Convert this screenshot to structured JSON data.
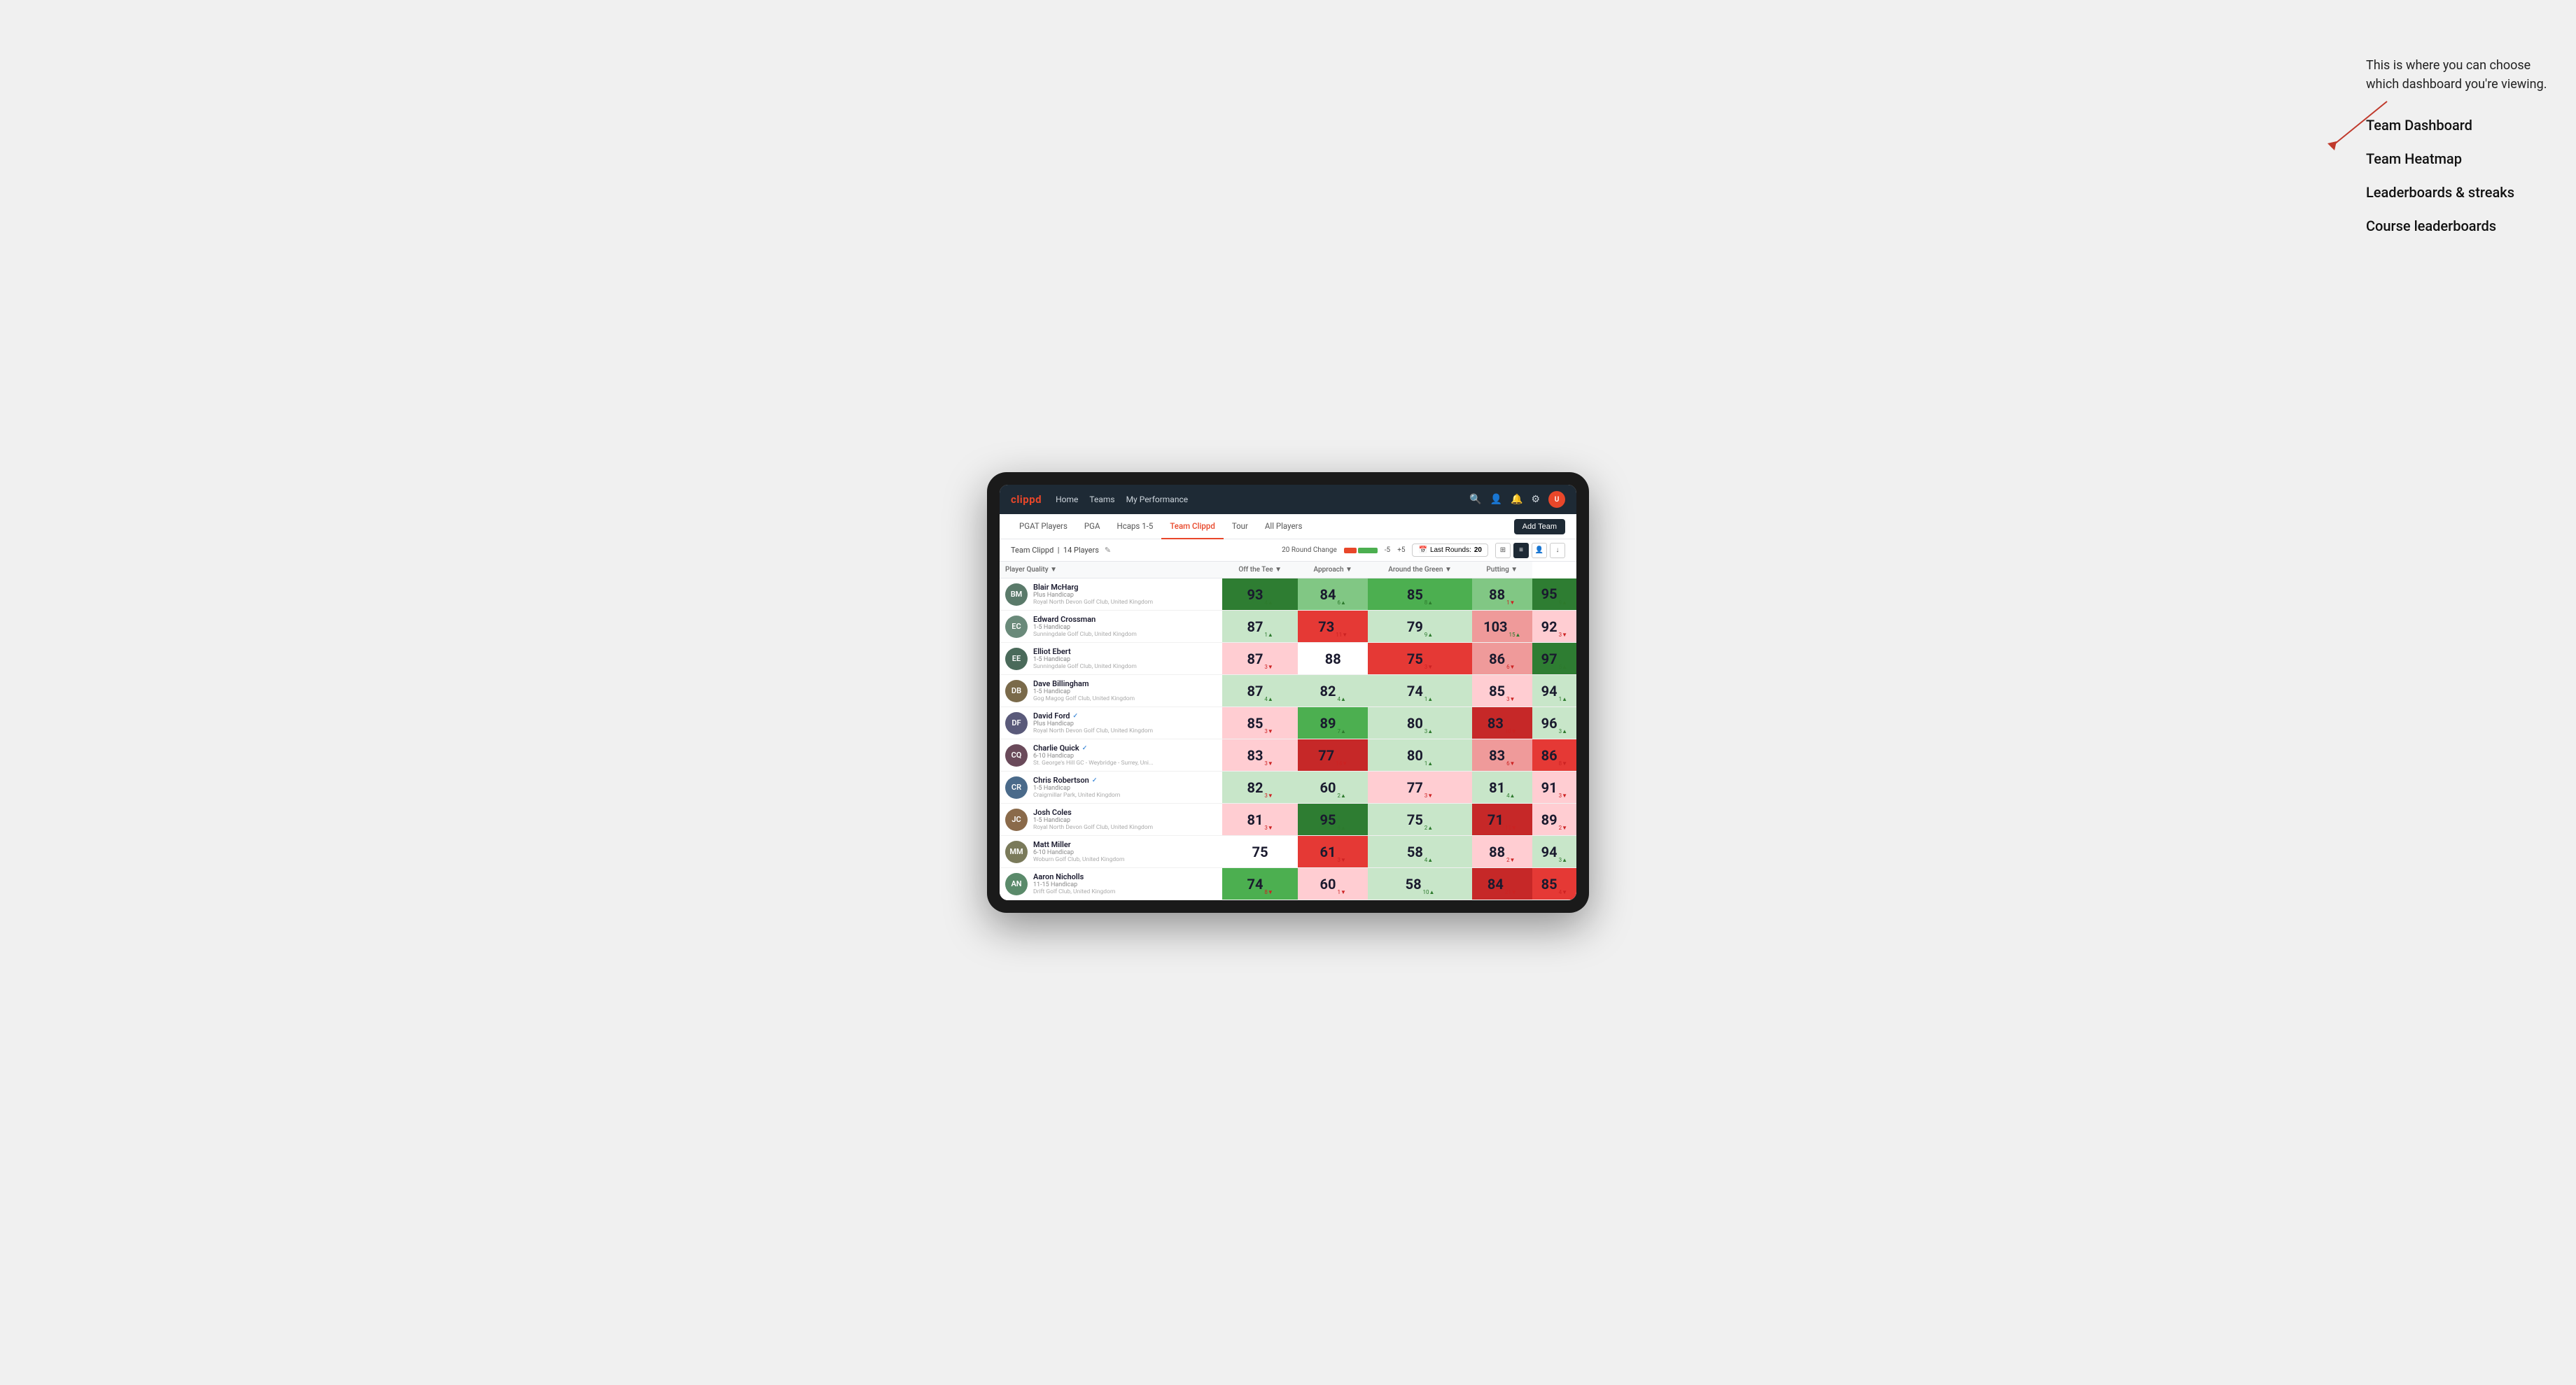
{
  "annotation": {
    "intro": "This is where you can choose which dashboard you're viewing.",
    "items": [
      "Team Dashboard",
      "Team Heatmap",
      "Leaderboards & streaks",
      "Course leaderboards"
    ]
  },
  "navbar": {
    "brand": "clippd",
    "links": [
      "Home",
      "Teams",
      "My Performance"
    ],
    "add_team_label": "Add Team"
  },
  "sub_nav": {
    "tabs": [
      "PGAT Players",
      "PGA",
      "Hcaps 1-5",
      "Team Clippd",
      "Tour",
      "All Players"
    ],
    "active_tab": "Team Clippd"
  },
  "team_header": {
    "team_name": "Team Clippd",
    "player_count": "14 Players",
    "round_change_label": "20 Round Change",
    "neg_label": "-5",
    "pos_label": "+5",
    "last_rounds_label": "Last Rounds:",
    "last_rounds_value": "20"
  },
  "table": {
    "columns": {
      "player": "Player Quality",
      "off_tee": "Off the Tee",
      "approach": "Approach",
      "around_green": "Around the Green",
      "putting": "Putting"
    },
    "rows": [
      {
        "name": "Blair McHarg",
        "handicap": "Plus Handicap",
        "club": "Royal North Devon Golf Club, United Kingdom",
        "avatar_color": "#5a7a6a",
        "initials": "BM",
        "verified": false,
        "scores": {
          "quality": {
            "val": "93",
            "change": "+4",
            "dir": "up",
            "bg": "bg-green-dark"
          },
          "off_tee": {
            "val": "84",
            "change": "+6",
            "dir": "up",
            "bg": "bg-green-light"
          },
          "approach": {
            "val": "85",
            "change": "+8",
            "dir": "up",
            "bg": "bg-green-mid"
          },
          "around_green": {
            "val": "88",
            "change": "-1",
            "dir": "down",
            "bg": "bg-green-light"
          },
          "putting": {
            "val": "95",
            "change": "+9",
            "dir": "up",
            "bg": "bg-green-dark"
          }
        }
      },
      {
        "name": "Edward Crossman",
        "handicap": "1-5 Handicap",
        "club": "Sunningdale Golf Club, United Kingdom",
        "avatar_color": "#6a8a7a",
        "initials": "EC",
        "verified": false,
        "scores": {
          "quality": {
            "val": "87",
            "change": "+1",
            "dir": "up",
            "bg": "bg-green-pale"
          },
          "off_tee": {
            "val": "73",
            "change": "-11",
            "dir": "down",
            "bg": "bg-red-mid"
          },
          "approach": {
            "val": "79",
            "change": "+9",
            "dir": "up",
            "bg": "bg-green-pale"
          },
          "around_green": {
            "val": "103",
            "change": "+15",
            "dir": "up",
            "bg": "bg-red-light"
          },
          "putting": {
            "val": "92",
            "change": "-3",
            "dir": "down",
            "bg": "bg-red-pale"
          }
        }
      },
      {
        "name": "Elliot Ebert",
        "handicap": "1-5 Handicap",
        "club": "Sunningdale Golf Club, United Kingdom",
        "avatar_color": "#4a6a5a",
        "initials": "EE",
        "verified": false,
        "scores": {
          "quality": {
            "val": "87",
            "change": "-3",
            "dir": "down",
            "bg": "bg-red-pale"
          },
          "off_tee": {
            "val": "88",
            "change": "",
            "dir": "",
            "bg": "bg-white"
          },
          "approach": {
            "val": "75",
            "change": "-3",
            "dir": "down",
            "bg": "bg-red-mid"
          },
          "around_green": {
            "val": "86",
            "change": "-6",
            "dir": "down",
            "bg": "bg-red-light"
          },
          "putting": {
            "val": "97",
            "change": "+5",
            "dir": "up",
            "bg": "bg-green-dark"
          }
        }
      },
      {
        "name": "Dave Billingham",
        "handicap": "1-5 Handicap",
        "club": "Gog Magog Golf Club, United Kingdom",
        "avatar_color": "#7a6a4a",
        "initials": "DB",
        "verified": false,
        "scores": {
          "quality": {
            "val": "87",
            "change": "+4",
            "dir": "up",
            "bg": "bg-green-pale"
          },
          "off_tee": {
            "val": "82",
            "change": "+4",
            "dir": "up",
            "bg": "bg-green-pale"
          },
          "approach": {
            "val": "74",
            "change": "+1",
            "dir": "up",
            "bg": "bg-green-pale"
          },
          "around_green": {
            "val": "85",
            "change": "-3",
            "dir": "down",
            "bg": "bg-red-pale"
          },
          "putting": {
            "val": "94",
            "change": "+1",
            "dir": "up",
            "bg": "bg-green-pale"
          }
        }
      },
      {
        "name": "David Ford",
        "handicap": "Plus Handicap",
        "club": "Royal North Devon Golf Club, United Kingdom",
        "avatar_color": "#5a5a7a",
        "initials": "DF",
        "verified": true,
        "scores": {
          "quality": {
            "val": "85",
            "change": "-3",
            "dir": "down",
            "bg": "bg-red-pale"
          },
          "off_tee": {
            "val": "89",
            "change": "+7",
            "dir": "up",
            "bg": "bg-green-mid"
          },
          "approach": {
            "val": "80",
            "change": "+3",
            "dir": "up",
            "bg": "bg-green-pale"
          },
          "around_green": {
            "val": "83",
            "change": "-10",
            "dir": "down",
            "bg": "bg-red-dark"
          },
          "putting": {
            "val": "96",
            "change": "+3",
            "dir": "up",
            "bg": "bg-green-pale"
          }
        }
      },
      {
        "name": "Charlie Quick",
        "handicap": "6-10 Handicap",
        "club": "St. George's Hill GC - Weybridge - Surrey, Uni...",
        "avatar_color": "#6a4a5a",
        "initials": "CQ",
        "verified": true,
        "scores": {
          "quality": {
            "val": "83",
            "change": "-3",
            "dir": "down",
            "bg": "bg-red-pale"
          },
          "off_tee": {
            "val": "77",
            "change": "-14",
            "dir": "down",
            "bg": "bg-red-dark"
          },
          "approach": {
            "val": "80",
            "change": "+1",
            "dir": "up",
            "bg": "bg-green-pale"
          },
          "around_green": {
            "val": "83",
            "change": "-6",
            "dir": "down",
            "bg": "bg-red-light"
          },
          "putting": {
            "val": "86",
            "change": "-8",
            "dir": "down",
            "bg": "bg-red-mid"
          }
        }
      },
      {
        "name": "Chris Robertson",
        "handicap": "1-5 Handicap",
        "club": "Craigmillar Park, United Kingdom",
        "avatar_color": "#4a6a8a",
        "initials": "CR",
        "verified": true,
        "scores": {
          "quality": {
            "val": "82",
            "change": "-3",
            "dir": "down",
            "bg": "bg-green-pale"
          },
          "off_tee": {
            "val": "60",
            "change": "+2",
            "dir": "up",
            "bg": "bg-green-pale"
          },
          "approach": {
            "val": "77",
            "change": "-3",
            "dir": "down",
            "bg": "bg-red-pale"
          },
          "around_green": {
            "val": "81",
            "change": "+4",
            "dir": "up",
            "bg": "bg-green-pale"
          },
          "putting": {
            "val": "91",
            "change": "-3",
            "dir": "down",
            "bg": "bg-red-pale"
          }
        }
      },
      {
        "name": "Josh Coles",
        "handicap": "1-5 Handicap",
        "club": "Royal North Devon Golf Club, United Kingdom",
        "avatar_color": "#8a6a4a",
        "initials": "JC",
        "verified": false,
        "scores": {
          "quality": {
            "val": "81",
            "change": "-3",
            "dir": "down",
            "bg": "bg-red-pale"
          },
          "off_tee": {
            "val": "95",
            "change": "+8",
            "dir": "up",
            "bg": "bg-green-dark"
          },
          "approach": {
            "val": "75",
            "change": "+2",
            "dir": "up",
            "bg": "bg-green-pale"
          },
          "around_green": {
            "val": "71",
            "change": "-11",
            "dir": "down",
            "bg": "bg-red-dark"
          },
          "putting": {
            "val": "89",
            "change": "-2",
            "dir": "down",
            "bg": "bg-red-pale"
          }
        }
      },
      {
        "name": "Matt Miller",
        "handicap": "6-10 Handicap",
        "club": "Woburn Golf Club, United Kingdom",
        "avatar_color": "#7a7a5a",
        "initials": "MM",
        "verified": false,
        "scores": {
          "quality": {
            "val": "75",
            "change": "",
            "dir": "",
            "bg": "bg-white"
          },
          "off_tee": {
            "val": "61",
            "change": "-3",
            "dir": "down",
            "bg": "bg-red-mid"
          },
          "approach": {
            "val": "58",
            "change": "+4",
            "dir": "up",
            "bg": "bg-green-pale"
          },
          "around_green": {
            "val": "88",
            "change": "-2",
            "dir": "down",
            "bg": "bg-red-pale"
          },
          "putting": {
            "val": "94",
            "change": "+3",
            "dir": "up",
            "bg": "bg-green-pale"
          }
        }
      },
      {
        "name": "Aaron Nicholls",
        "handicap": "11-15 Handicap",
        "club": "Drift Golf Club, United Kingdom",
        "avatar_color": "#5a8a6a",
        "initials": "AN",
        "verified": false,
        "scores": {
          "quality": {
            "val": "74",
            "change": "-8",
            "dir": "down",
            "bg": "bg-green-mid"
          },
          "off_tee": {
            "val": "60",
            "change": "-1",
            "dir": "down",
            "bg": "bg-red-pale"
          },
          "approach": {
            "val": "58",
            "change": "+10",
            "dir": "up",
            "bg": "bg-green-pale"
          },
          "around_green": {
            "val": "84",
            "change": "-21",
            "dir": "down",
            "bg": "bg-red-dark"
          },
          "putting": {
            "val": "85",
            "change": "-4",
            "dir": "down",
            "bg": "bg-red-mid"
          }
        }
      }
    ]
  }
}
